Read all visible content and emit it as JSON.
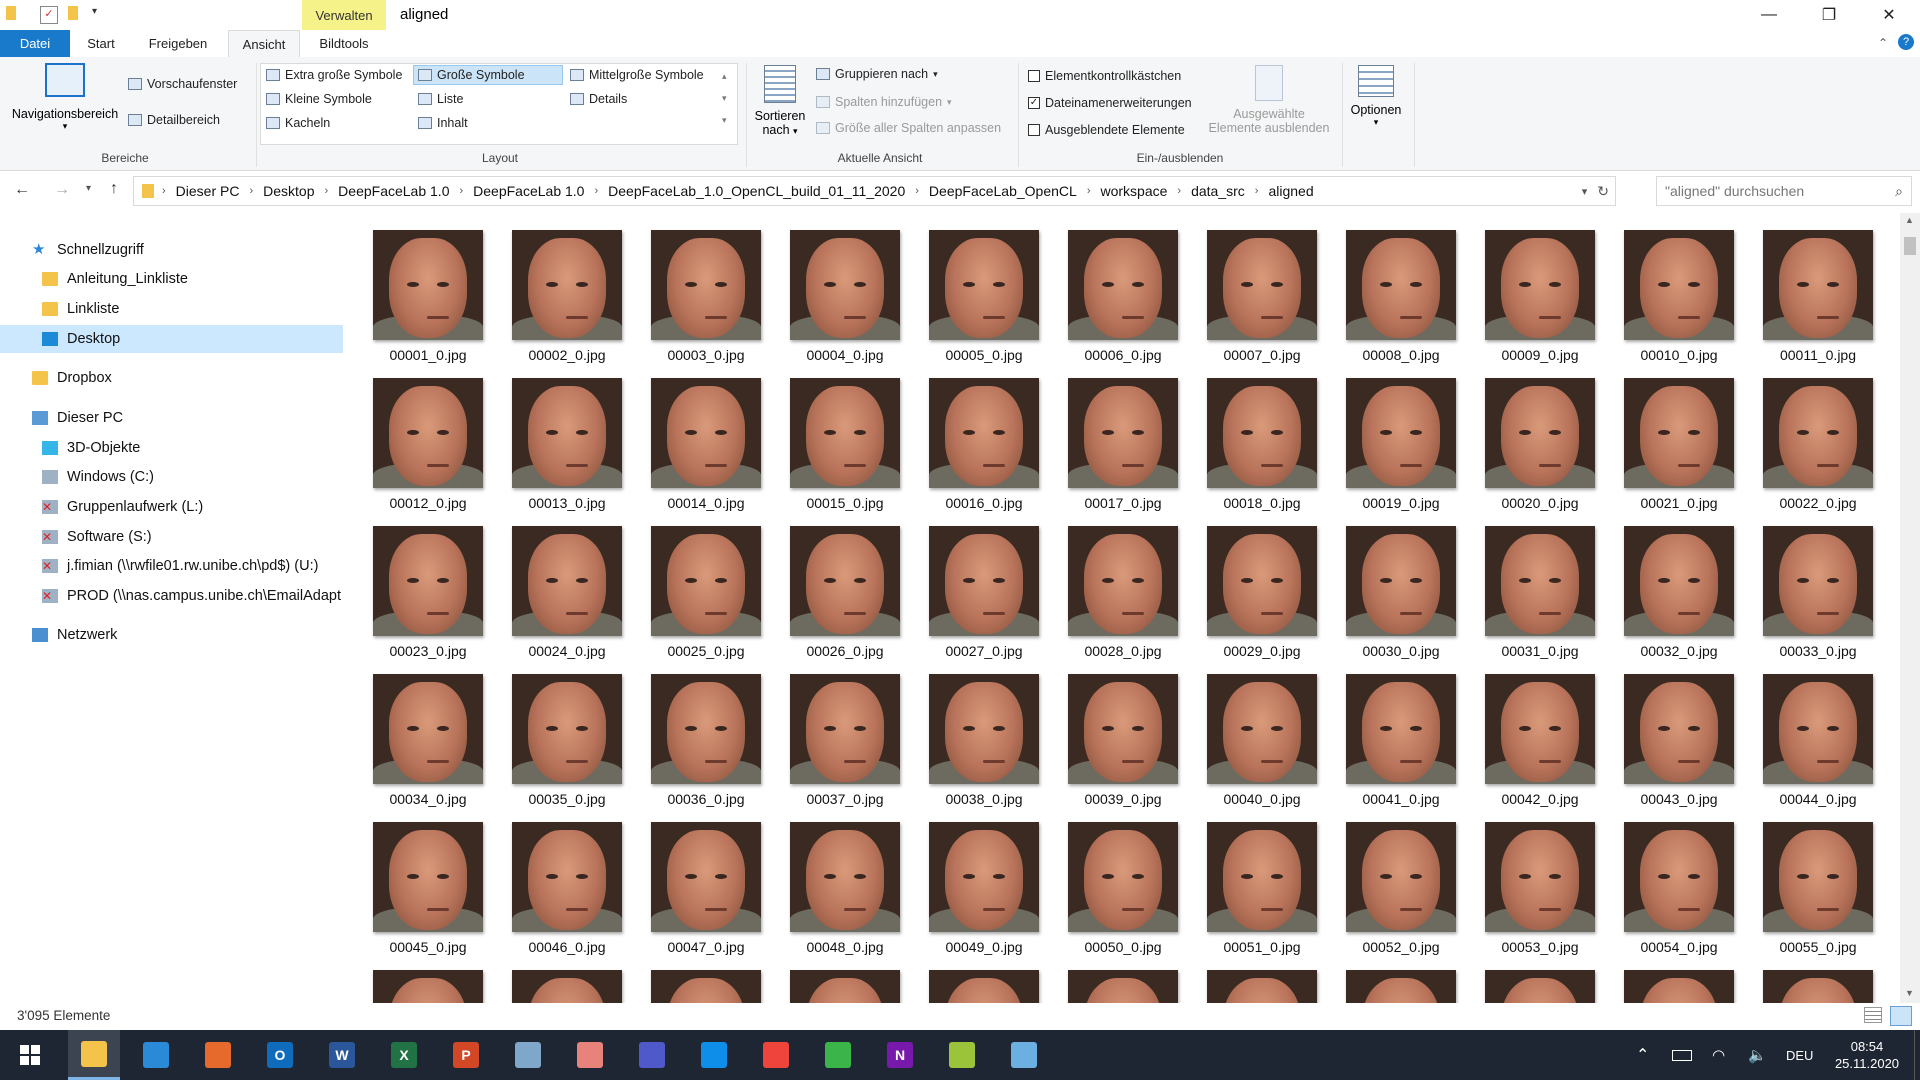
{
  "window": {
    "title": "aligned",
    "context_tab": "Verwalten",
    "buttons": {
      "minimize": "—",
      "maximize": "❐",
      "close": "✕"
    }
  },
  "ribbon_tabs": [
    "Datei",
    "Start",
    "Freigeben",
    "Ansicht",
    "Bildtools"
  ],
  "ribbon": {
    "bereiche": {
      "label": "Bereiche",
      "navigationsbereich": "Navigationsbereich",
      "vorschaufenster": "Vorschaufenster",
      "detailbereich": "Detailbereich"
    },
    "layout": {
      "label": "Layout",
      "items": [
        "Extra große Symbole",
        "Große Symbole",
        "Mittelgroße Symbole",
        "Kleine Symbole",
        "Liste",
        "Details",
        "Kacheln",
        "Inhalt"
      ],
      "selected": "Große Symbole"
    },
    "aktuelle_ansicht": {
      "label": "Aktuelle Ansicht",
      "sortieren": "Sortieren",
      "nach": "nach",
      "gruppieren": "Gruppieren nach",
      "spalten": "Spalten hinzufügen",
      "groesse": "Größe aller Spalten anpassen"
    },
    "ein_ausblenden": {
      "label": "Ein-/ausblenden",
      "elementkontroll": "Elementkontrollkästchen",
      "dateinamen": "Dateinamenerweiterungen",
      "ausgeblendete": "Ausgeblendete Elemente",
      "ausgewaehlte_1": "Ausgewählte",
      "ausgewaehlte_2": "Elemente ausblenden"
    },
    "optionen": "Optionen"
  },
  "breadcrumb": [
    "Dieser PC",
    "Desktop",
    "DeepFaceLab 1.0",
    "DeepFaceLab 1.0",
    "DeepFaceLab_1.0_OpenCL_build_01_11_2020",
    "DeepFaceLab_OpenCL",
    "workspace",
    "data_src",
    "aligned"
  ],
  "search": {
    "placeholder": "\"aligned\" durchsuchen"
  },
  "nav": {
    "schnellzugriff": "Schnellzugriff",
    "anleitung": "Anleitung_Linkliste",
    "linkliste": "Linkliste",
    "desktop": "Desktop",
    "dropbox": "Dropbox",
    "dieser_pc": "Dieser PC",
    "objekte3d": "3D-Objekte",
    "windows": "Windows (C:)",
    "gruppen": "Gruppenlaufwerk (L:)",
    "software": "Software (S:)",
    "fimian": "j.fimian (\\\\rwfile01.rw.unibe.ch\\pd$) (U:)",
    "prod": "PROD (\\\\nas.campus.unibe.ch\\EmailAdapt",
    "netzwerk": "Netzwerk"
  },
  "files": [
    "00001_0.jpg",
    "00002_0.jpg",
    "00003_0.jpg",
    "00004_0.jpg",
    "00005_0.jpg",
    "00006_0.jpg",
    "00007_0.jpg",
    "00008_0.jpg",
    "00009_0.jpg",
    "00010_0.jpg",
    "00011_0.jpg",
    "00012_0.jpg",
    "00013_0.jpg",
    "00014_0.jpg",
    "00015_0.jpg",
    "00016_0.jpg",
    "00017_0.jpg",
    "00018_0.jpg",
    "00019_0.jpg",
    "00020_0.jpg",
    "00021_0.jpg",
    "00022_0.jpg",
    "00023_0.jpg",
    "00024_0.jpg",
    "00025_0.jpg",
    "00026_0.jpg",
    "00027_0.jpg",
    "00028_0.jpg",
    "00029_0.jpg",
    "00030_0.jpg",
    "00031_0.jpg",
    "00032_0.jpg",
    "00033_0.jpg",
    "00034_0.jpg",
    "00035_0.jpg",
    "00036_0.jpg",
    "00037_0.jpg",
    "00038_0.jpg",
    "00039_0.jpg",
    "00040_0.jpg",
    "00041_0.jpg",
    "00042_0.jpg",
    "00043_0.jpg",
    "00044_0.jpg",
    "00045_0.jpg",
    "00046_0.jpg",
    "00047_0.jpg",
    "00048_0.jpg",
    "00049_0.jpg",
    "00050_0.jpg",
    "00051_0.jpg",
    "00052_0.jpg",
    "00053_0.jpg",
    "00054_0.jpg",
    "00055_0.jpg",
    "",
    "",
    "",
    "",
    "",
    "",
    "",
    "",
    "",
    "",
    ""
  ],
  "status": {
    "count": "3'095 Elemente"
  },
  "taskbar": {
    "apps": [
      "file-explorer",
      "internet-explorer",
      "firefox",
      "outlook",
      "word",
      "excel",
      "powerpoint",
      "remote-desktop",
      "kaleidoscope",
      "teams",
      "teamviewer",
      "anydesk",
      "camtasia",
      "onenote",
      "add-app",
      "paint"
    ],
    "letters": {
      "outlook": "O",
      "word": "W",
      "excel": "X",
      "powerpoint": "P",
      "onenote": "N"
    },
    "language": "DEU",
    "time": "08:54",
    "date": "25.11.2020"
  }
}
